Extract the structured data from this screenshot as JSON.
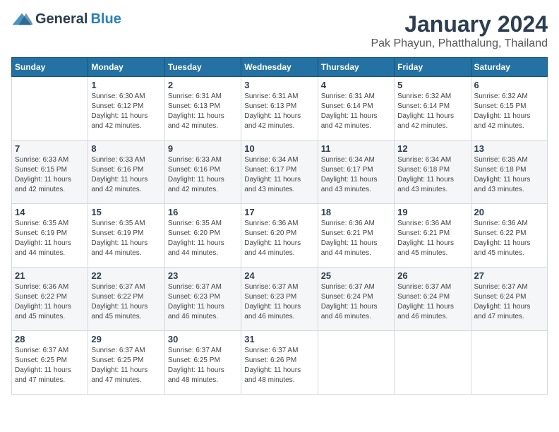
{
  "logo": {
    "general": "General",
    "blue": "Blue"
  },
  "title": "January 2024",
  "location": "Pak Phayun, Phatthalung, Thailand",
  "days_of_week": [
    "Sunday",
    "Monday",
    "Tuesday",
    "Wednesday",
    "Thursday",
    "Friday",
    "Saturday"
  ],
  "weeks": [
    [
      {
        "day": "",
        "info": ""
      },
      {
        "day": "1",
        "info": "Sunrise: 6:30 AM\nSunset: 6:12 PM\nDaylight: 11 hours\nand 42 minutes."
      },
      {
        "day": "2",
        "info": "Sunrise: 6:31 AM\nSunset: 6:13 PM\nDaylight: 11 hours\nand 42 minutes."
      },
      {
        "day": "3",
        "info": "Sunrise: 6:31 AM\nSunset: 6:13 PM\nDaylight: 11 hours\nand 42 minutes."
      },
      {
        "day": "4",
        "info": "Sunrise: 6:31 AM\nSunset: 6:14 PM\nDaylight: 11 hours\nand 42 minutes."
      },
      {
        "day": "5",
        "info": "Sunrise: 6:32 AM\nSunset: 6:14 PM\nDaylight: 11 hours\nand 42 minutes."
      },
      {
        "day": "6",
        "info": "Sunrise: 6:32 AM\nSunset: 6:15 PM\nDaylight: 11 hours\nand 42 minutes."
      }
    ],
    [
      {
        "day": "7",
        "info": "Sunrise: 6:33 AM\nSunset: 6:15 PM\nDaylight: 11 hours\nand 42 minutes."
      },
      {
        "day": "8",
        "info": "Sunrise: 6:33 AM\nSunset: 6:16 PM\nDaylight: 11 hours\nand 42 minutes."
      },
      {
        "day": "9",
        "info": "Sunrise: 6:33 AM\nSunset: 6:16 PM\nDaylight: 11 hours\nand 42 minutes."
      },
      {
        "day": "10",
        "info": "Sunrise: 6:34 AM\nSunset: 6:17 PM\nDaylight: 11 hours\nand 43 minutes."
      },
      {
        "day": "11",
        "info": "Sunrise: 6:34 AM\nSunset: 6:17 PM\nDaylight: 11 hours\nand 43 minutes."
      },
      {
        "day": "12",
        "info": "Sunrise: 6:34 AM\nSunset: 6:18 PM\nDaylight: 11 hours\nand 43 minutes."
      },
      {
        "day": "13",
        "info": "Sunrise: 6:35 AM\nSunset: 6:18 PM\nDaylight: 11 hours\nand 43 minutes."
      }
    ],
    [
      {
        "day": "14",
        "info": "Sunrise: 6:35 AM\nSunset: 6:19 PM\nDaylight: 11 hours\nand 44 minutes."
      },
      {
        "day": "15",
        "info": "Sunrise: 6:35 AM\nSunset: 6:19 PM\nDaylight: 11 hours\nand 44 minutes."
      },
      {
        "day": "16",
        "info": "Sunrise: 6:35 AM\nSunset: 6:20 PM\nDaylight: 11 hours\nand 44 minutes."
      },
      {
        "day": "17",
        "info": "Sunrise: 6:36 AM\nSunset: 6:20 PM\nDaylight: 11 hours\nand 44 minutes."
      },
      {
        "day": "18",
        "info": "Sunrise: 6:36 AM\nSunset: 6:21 PM\nDaylight: 11 hours\nand 44 minutes."
      },
      {
        "day": "19",
        "info": "Sunrise: 6:36 AM\nSunset: 6:21 PM\nDaylight: 11 hours\nand 45 minutes."
      },
      {
        "day": "20",
        "info": "Sunrise: 6:36 AM\nSunset: 6:22 PM\nDaylight: 11 hours\nand 45 minutes."
      }
    ],
    [
      {
        "day": "21",
        "info": "Sunrise: 6:36 AM\nSunset: 6:22 PM\nDaylight: 11 hours\nand 45 minutes."
      },
      {
        "day": "22",
        "info": "Sunrise: 6:37 AM\nSunset: 6:22 PM\nDaylight: 11 hours\nand 45 minutes."
      },
      {
        "day": "23",
        "info": "Sunrise: 6:37 AM\nSunset: 6:23 PM\nDaylight: 11 hours\nand 46 minutes."
      },
      {
        "day": "24",
        "info": "Sunrise: 6:37 AM\nSunset: 6:23 PM\nDaylight: 11 hours\nand 46 minutes."
      },
      {
        "day": "25",
        "info": "Sunrise: 6:37 AM\nSunset: 6:24 PM\nDaylight: 11 hours\nand 46 minutes."
      },
      {
        "day": "26",
        "info": "Sunrise: 6:37 AM\nSunset: 6:24 PM\nDaylight: 11 hours\nand 46 minutes."
      },
      {
        "day": "27",
        "info": "Sunrise: 6:37 AM\nSunset: 6:24 PM\nDaylight: 11 hours\nand 47 minutes."
      }
    ],
    [
      {
        "day": "28",
        "info": "Sunrise: 6:37 AM\nSunset: 6:25 PM\nDaylight: 11 hours\nand 47 minutes."
      },
      {
        "day": "29",
        "info": "Sunrise: 6:37 AM\nSunset: 6:25 PM\nDaylight: 11 hours\nand 47 minutes."
      },
      {
        "day": "30",
        "info": "Sunrise: 6:37 AM\nSunset: 6:25 PM\nDaylight: 11 hours\nand 48 minutes."
      },
      {
        "day": "31",
        "info": "Sunrise: 6:37 AM\nSunset: 6:26 PM\nDaylight: 11 hours\nand 48 minutes."
      },
      {
        "day": "",
        "info": ""
      },
      {
        "day": "",
        "info": ""
      },
      {
        "day": "",
        "info": ""
      }
    ]
  ]
}
